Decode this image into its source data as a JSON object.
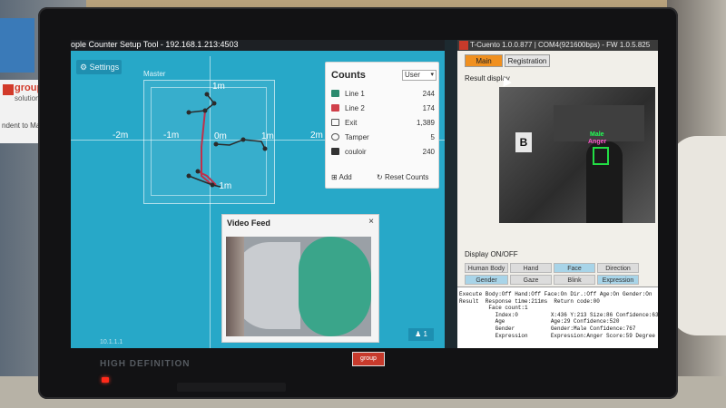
{
  "left_app": {
    "title": "ople Counter Setup Tool - 192.168.1.213:4503",
    "settings_label": "Settings",
    "master_label": "Master",
    "grid_labels": {
      "m1_top": "1m",
      "m2_neg": "-2m",
      "m1_neg": "-1m",
      "m0": "0m",
      "m1": "1m",
      "m2": "2m",
      "m1_bottom": "-1m"
    },
    "status": "10.1.1.1",
    "corner_badge": "1",
    "colors": {
      "background": "#27a8c8",
      "line_primary": "#c0304a",
      "line_secondary": "#2b2b2b"
    }
  },
  "counts": {
    "title": "Counts",
    "select_value": "User",
    "rows": [
      {
        "label": "Line 1",
        "value": "244",
        "icon": "line1-icon",
        "color": "#2c8a6e"
      },
      {
        "label": "Line 2",
        "value": "174",
        "icon": "line2-icon",
        "color": "#d0404a"
      },
      {
        "label": "Exit",
        "value": "1,389",
        "icon": "exit-icon",
        "color": "#555555"
      },
      {
        "label": "Tamper",
        "value": "5",
        "icon": "tamper-icon",
        "color": "#555555"
      },
      {
        "label": "couloir",
        "value": "240",
        "icon": "list-icon",
        "color": "#333333"
      }
    ],
    "add_label": "Add",
    "reset_label": "Reset Counts"
  },
  "video_feed": {
    "title": "Video Feed",
    "close": "×"
  },
  "right_app": {
    "title": "T-Cuento   1.0.0.877 | COM4(921600bps) - FW 1.0.5.825",
    "tabs": [
      {
        "label": "Main",
        "active": true
      },
      {
        "label": "Registration",
        "active": false
      }
    ],
    "result_label": "Result display",
    "result_image": {
      "sign": "B",
      "tag_gender": "Male",
      "tag_expression": "Anger"
    },
    "display_label": "Display ON/OFF",
    "display_row1": [
      {
        "label": "Human Body",
        "on": false
      },
      {
        "label": "Hand",
        "on": false
      },
      {
        "label": "Face",
        "on": true
      },
      {
        "label": "Direction",
        "on": false
      }
    ],
    "display_row2": [
      {
        "label": "Gender",
        "on": true
      },
      {
        "label": "Gaze",
        "on": false
      },
      {
        "label": "Blink",
        "on": false
      },
      {
        "label": "Expression",
        "on": true
      }
    ],
    "console_lines": [
      "Execute Body:Off Hand:Off Face:On Dir.:Off Age:On Gender:On",
      "Result  Response time:211ms  Return code:00",
      "         Face count:1",
      "           Index:0          X:436 Y:213 Size:86 Confidence:63",
      "           Age              Age:29 Confidence:520",
      "           Gender           Gender:Male Confidence:767",
      "           Expression       Expression:Anger Score:59 Degree"
    ]
  },
  "monitor": {
    "brand": "HIGH DEFINITION",
    "logo_text": "group"
  }
}
